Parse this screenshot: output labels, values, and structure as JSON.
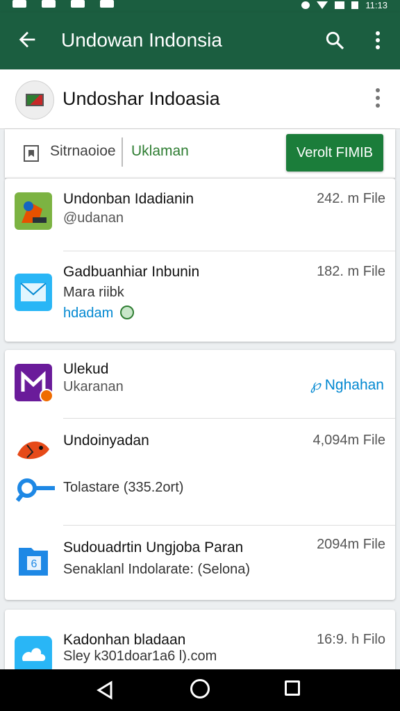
{
  "status_bar": {
    "time": "11:13"
  },
  "app_bar": {
    "title": "Undowan Indonsia"
  },
  "header": {
    "title": "Undoshar Indoasia"
  },
  "filter": {
    "label": "Sitrnaoioe",
    "tab": "Uklaman",
    "button": "Verolt FIMIB"
  },
  "items": [
    {
      "title": "Undonban Idadianin",
      "subtitle": "@udanan",
      "size": "242. m File",
      "icon": "app-icon-colorful"
    },
    {
      "title": "Gadbuanhiar Inbunin",
      "subtitle": "Mara riibk",
      "link": "hdadam",
      "size": "182. m File",
      "icon": "mail-icon"
    },
    {
      "title": "Ulekud",
      "subtitle": "Ukaranan",
      "action": "Nghahan",
      "icon": "m-logo-icon"
    },
    {
      "title": "Undoinyadan",
      "subtitle": "Tolastare (335.2ort)",
      "size": "4,094m File",
      "icon": "fish-icon"
    },
    {
      "title": "Sudouadrtin Ungjoba Paran",
      "subtitle": "Senaklanl Indolarate: (Selona)",
      "size": "2094m File",
      "icon": "book-icon"
    },
    {
      "title": "Kadonhan bladaan",
      "subtitle": "Sley k301doar1a6 l).com",
      "size": "16:9. h Filo",
      "icon": "cloud-icon"
    }
  ],
  "colors": {
    "primary": "#1b5e40",
    "accent_button": "#1b7d3a",
    "tab_text": "#2e7d32",
    "link": "#0288d1"
  }
}
